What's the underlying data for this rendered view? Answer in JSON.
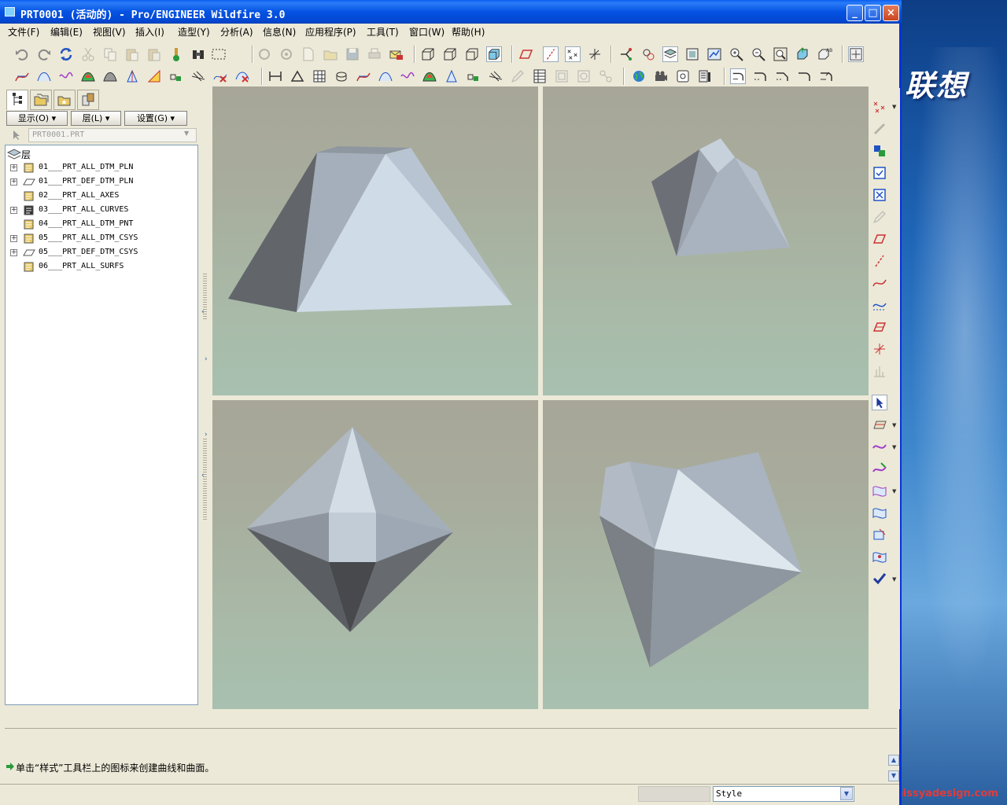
{
  "desktop": {
    "brand_text": "联想",
    "watermark_url": "www.missyadesign.com"
  },
  "window": {
    "title": "PRT0001 (活动的) - Pro/ENGINEER Wildfire 3.0",
    "controls": {
      "minimize": "_",
      "maximize": "□",
      "close": "×"
    }
  },
  "menu": {
    "items": [
      "文件(F)",
      "编辑(E)",
      "视图(V)",
      "插入(I)",
      "造型(Y)",
      "分析(A)",
      "信息(N)",
      "应用程序(P)",
      "工具(T)",
      "窗口(W)",
      "帮助(H)"
    ]
  },
  "panel": {
    "buttons": {
      "display": "显示(O) ▾",
      "layer": "层(L) ▾",
      "settings": "设置(G) ▾"
    },
    "active_model": "PRT0001.PRT",
    "tree_root": "层",
    "layers": [
      {
        "name": "01___PRT_ALL_DTM_PLN",
        "expandable": true
      },
      {
        "name": "01___PRT_DEF_DTM_PLN",
        "expandable": true
      },
      {
        "name": "02___PRT_ALL_AXES",
        "expandable": false
      },
      {
        "name": "03___PRT_ALL_CURVES",
        "expandable": true
      },
      {
        "name": "04___PRT_ALL_DTM_PNT",
        "expandable": false
      },
      {
        "name": "05___PRT_ALL_DTM_CSYS",
        "expandable": true
      },
      {
        "name": "05___PRT_DEF_DTM_CSYS",
        "expandable": true
      },
      {
        "name": "06___PRT_ALL_SURFS",
        "expandable": false
      }
    ]
  },
  "message": {
    "text": "单击“样式”工具栏上的图标来创建曲线和曲面。"
  },
  "status": {
    "filter_value": "Style"
  },
  "colors": {
    "title_blue": "#0553e3",
    "viewport_top": "#a7a698",
    "viewport_bottom": "#a8c0b0",
    "model_light": "#cfdbe6",
    "model_mid": "#a7b1bd",
    "model_dark": "#5f6368"
  }
}
